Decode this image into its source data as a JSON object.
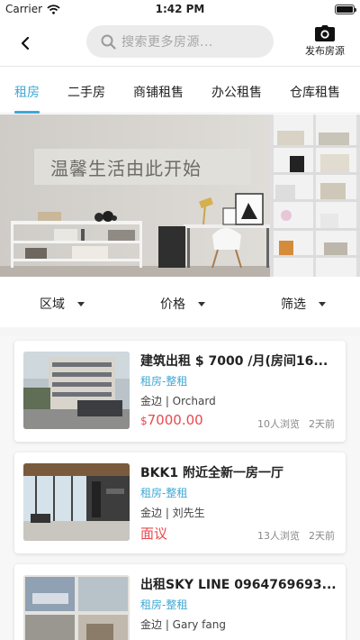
{
  "status_bar": {
    "carrier": "Carrier",
    "time": "1:42 PM"
  },
  "nav": {
    "back_icon": "chevron-left-icon",
    "search_placeholder": "搜索更多房源...",
    "publish_label": "发布房源",
    "publish_icon": "camera-icon"
  },
  "tabs": [
    {
      "label": "租房",
      "active": true
    },
    {
      "label": "二手房",
      "active": false
    },
    {
      "label": "商铺租售",
      "active": false
    },
    {
      "label": "办公租售",
      "active": false
    },
    {
      "label": "仓库租售",
      "active": false
    }
  ],
  "banner": {
    "title": "温馨生活由此开始"
  },
  "filters": [
    {
      "label": "区域"
    },
    {
      "label": "价格"
    },
    {
      "label": "筛选"
    }
  ],
  "colors": {
    "accent": "#3fa9d6",
    "price": "#e8494d"
  },
  "listings": [
    {
      "title": "建筑出租 $ 7000 /月(房间16...",
      "category": "租房-整租",
      "location": "金边 | Orchard",
      "price_prefix": "$",
      "price": "7000.00",
      "views": "10人浏览",
      "posted": "2天前"
    },
    {
      "title": "BKK1 附近全新一房一厅",
      "category": "租房-整租",
      "location": "金边 | 刘先生",
      "price_prefix": "",
      "price": "面议",
      "views": "13人浏览",
      "posted": "2天前"
    },
    {
      "title": "出租SKY LINE 0964769693...",
      "category": "租房-整租",
      "location": "金边 | Gary fang",
      "price_prefix": "",
      "price": "",
      "views": "",
      "posted": ""
    }
  ]
}
